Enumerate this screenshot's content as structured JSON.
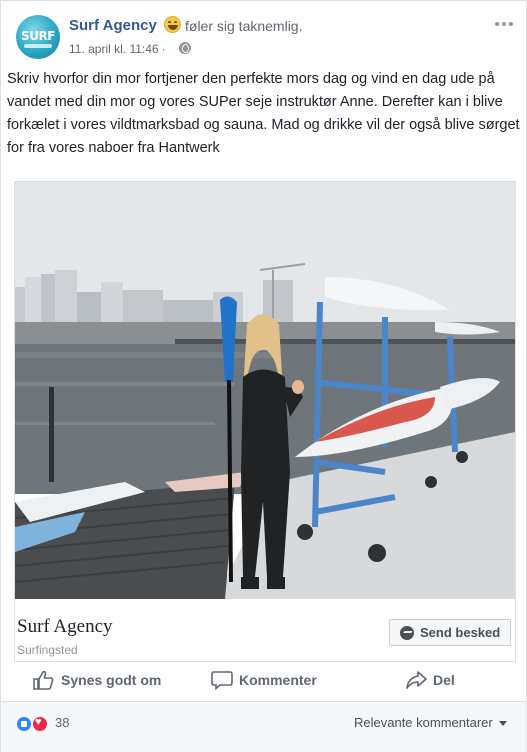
{
  "post": {
    "page_name": "Surf Agency",
    "avatar_text": "SURF",
    "feeling": "føler sig taknemlig.",
    "timestamp": "11. april kl. 11:46",
    "separator": "·",
    "text": "Skriv hvorfor din mor fortjener den perfekte mors dag og vind en dag ude på vandet med din mor og vores SUPer seje instruktør Anne. Derefter kan i blive forkælet i vores vildtmarksbad og sauna. Mad og drikke vil der også blive sørget for fra vores naboer fra Hantwerk"
  },
  "attachment": {
    "title": "Surf Agency",
    "subtitle": "Surfingsted",
    "send_button": "Send besked",
    "image_icon": "photo-woman-with-paddle-on-dock"
  },
  "actions": {
    "like": "Synes godt om",
    "comment": "Kommenter",
    "share": "Del"
  },
  "footer": {
    "reaction_count": "38",
    "relevant_label": "Relevante kommentarer"
  },
  "colors": {
    "link_blue": "#365899",
    "action_grey": "#606770",
    "like_blue": "#2d88ff",
    "love_red": "#f0284a"
  },
  "icons": [
    "feeling-emoji-icon",
    "globe-icon",
    "more-icon",
    "messenger-icon",
    "like-icon",
    "comment-icon",
    "share-icon",
    "react-like-icon",
    "react-love-icon",
    "caret-down-icon"
  ]
}
